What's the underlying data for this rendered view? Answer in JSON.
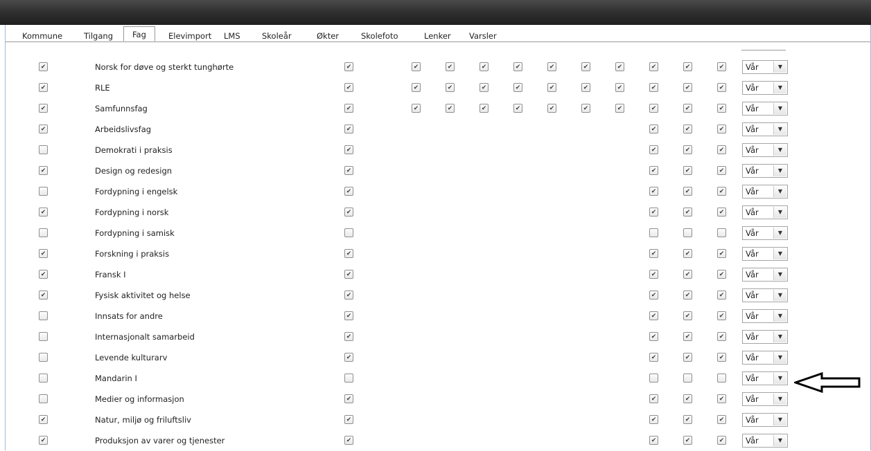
{
  "tabs": [
    {
      "label": "Kommune",
      "active": false
    },
    {
      "label": "Tilgang",
      "active": false
    },
    {
      "label": "Fag",
      "active": true
    },
    {
      "label": "Elevimport",
      "active": false
    },
    {
      "label": "LMS",
      "active": false
    },
    {
      "label": "Skoleår",
      "active": false
    },
    {
      "label": "Økter",
      "active": false
    },
    {
      "label": "Skolefoto",
      "active": false
    },
    {
      "label": "Lenker",
      "active": false
    },
    {
      "label": "Varsler",
      "active": false
    }
  ],
  "subjects": [
    {
      "name": "Norsk for døve og sterkt tunghørte",
      "active": true,
      "col2": true,
      "grades": [
        true,
        true,
        true,
        true,
        true,
        true,
        true,
        true,
        true,
        true
      ],
      "term": "Vår"
    },
    {
      "name": "RLE",
      "active": true,
      "col2": true,
      "grades": [
        true,
        true,
        true,
        true,
        true,
        true,
        true,
        true,
        true,
        true
      ],
      "term": "Vår"
    },
    {
      "name": "Samfunnsfag",
      "active": true,
      "col2": true,
      "grades": [
        true,
        true,
        true,
        true,
        true,
        true,
        true,
        true,
        true,
        true
      ],
      "term": "Vår"
    },
    {
      "name": "Arbeidslivsfag",
      "active": true,
      "col2": true,
      "grades": [
        null,
        null,
        null,
        null,
        null,
        null,
        null,
        true,
        true,
        true
      ],
      "term": "Vår"
    },
    {
      "name": "Demokrati i praksis",
      "active": false,
      "col2": true,
      "grades": [
        null,
        null,
        null,
        null,
        null,
        null,
        null,
        true,
        true,
        true
      ],
      "term": "Vår"
    },
    {
      "name": "Design og redesign",
      "active": true,
      "col2": true,
      "grades": [
        null,
        null,
        null,
        null,
        null,
        null,
        null,
        true,
        true,
        true
      ],
      "term": "Vår"
    },
    {
      "name": "Fordypning i engelsk",
      "active": false,
      "col2": true,
      "grades": [
        null,
        null,
        null,
        null,
        null,
        null,
        null,
        true,
        true,
        true
      ],
      "term": "Vår"
    },
    {
      "name": "Fordypning i norsk",
      "active": true,
      "col2": true,
      "grades": [
        null,
        null,
        null,
        null,
        null,
        null,
        null,
        true,
        true,
        true
      ],
      "term": "Vår"
    },
    {
      "name": "Fordypning i samisk",
      "active": false,
      "col2": false,
      "grades": [
        null,
        null,
        null,
        null,
        null,
        null,
        null,
        false,
        false,
        false
      ],
      "term": "Vår"
    },
    {
      "name": "Forskning i praksis",
      "active": true,
      "col2": true,
      "grades": [
        null,
        null,
        null,
        null,
        null,
        null,
        null,
        true,
        true,
        true
      ],
      "term": "Vår"
    },
    {
      "name": "Fransk I",
      "active": true,
      "col2": true,
      "grades": [
        null,
        null,
        null,
        null,
        null,
        null,
        null,
        true,
        true,
        true
      ],
      "term": "Vår"
    },
    {
      "name": "Fysisk aktivitet og helse",
      "active": true,
      "col2": true,
      "grades": [
        null,
        null,
        null,
        null,
        null,
        null,
        null,
        true,
        true,
        true
      ],
      "term": "Vår"
    },
    {
      "name": "Innsats for andre",
      "active": false,
      "col2": true,
      "grades": [
        null,
        null,
        null,
        null,
        null,
        null,
        null,
        true,
        true,
        true
      ],
      "term": "Vår"
    },
    {
      "name": "Internasjonalt samarbeid",
      "active": false,
      "col2": true,
      "grades": [
        null,
        null,
        null,
        null,
        null,
        null,
        null,
        true,
        true,
        true
      ],
      "term": "Vår"
    },
    {
      "name": "Levende kulturarv",
      "active": false,
      "col2": true,
      "grades": [
        null,
        null,
        null,
        null,
        null,
        null,
        null,
        true,
        true,
        true
      ],
      "term": "Vår"
    },
    {
      "name": "Mandarin I",
      "active": false,
      "col2": false,
      "grades": [
        null,
        null,
        null,
        null,
        null,
        null,
        null,
        false,
        false,
        false
      ],
      "term": "Vår"
    },
    {
      "name": "Medier og informasjon",
      "active": false,
      "col2": true,
      "grades": [
        null,
        null,
        null,
        null,
        null,
        null,
        null,
        true,
        true,
        true
      ],
      "term": "Vår"
    },
    {
      "name": "Natur, miljø og friluftsliv",
      "active": true,
      "col2": true,
      "grades": [
        null,
        null,
        null,
        null,
        null,
        null,
        null,
        true,
        true,
        true
      ],
      "term": "Vår"
    },
    {
      "name": "Produksjon av varer og tjenester",
      "active": true,
      "col2": true,
      "grades": [
        null,
        null,
        null,
        null,
        null,
        null,
        null,
        true,
        true,
        true
      ],
      "term": "Vår"
    }
  ],
  "annotation": {
    "icon": "arrow-left-icon",
    "points_to_row": "Mandarin I"
  }
}
